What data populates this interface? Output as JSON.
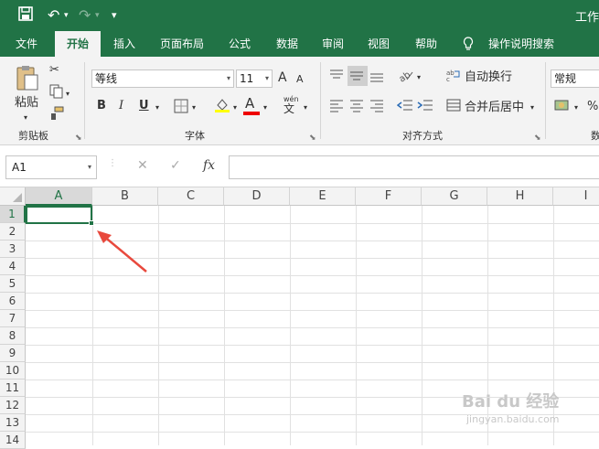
{
  "titlebar": {
    "undo": "↶",
    "redo": "↷",
    "customize": "▾",
    "doc_title": "工作"
  },
  "tabs": [
    "文件",
    "开始",
    "插入",
    "页面布局",
    "公式",
    "数据",
    "审阅",
    "视图",
    "帮助",
    "操作说明搜索"
  ],
  "ribbon": {
    "clipboard": {
      "paste": "粘贴",
      "group": "剪贴板"
    },
    "font": {
      "name": "等线",
      "size": "11",
      "group": "字体",
      "bold": "B",
      "italic": "I",
      "underline": "U",
      "grow": "A",
      "shrink": "A",
      "font_color": "A",
      "phonetic": "wén"
    },
    "alignment": {
      "wrap": "自动换行",
      "merge": "合并后居中",
      "group": "对齐方式"
    },
    "number": {
      "format": "常规",
      "percent": "%",
      "group": "数"
    }
  },
  "formula": {
    "namebox": "A1",
    "cancel": "✕",
    "enter": "✓",
    "fx": "fx"
  },
  "grid": {
    "columns": [
      "A",
      "B",
      "C",
      "D",
      "E",
      "F",
      "G",
      "H",
      "I"
    ],
    "rows": [
      "1",
      "2",
      "3",
      "4",
      "5",
      "6",
      "7",
      "8",
      "9",
      "10",
      "11",
      "12",
      "13",
      "14"
    ]
  },
  "accent": "#217346",
  "annotation_color": "#e8493d",
  "watermark": {
    "logo": "Bai du 经验",
    "url": "jingyan.baidu.com"
  }
}
